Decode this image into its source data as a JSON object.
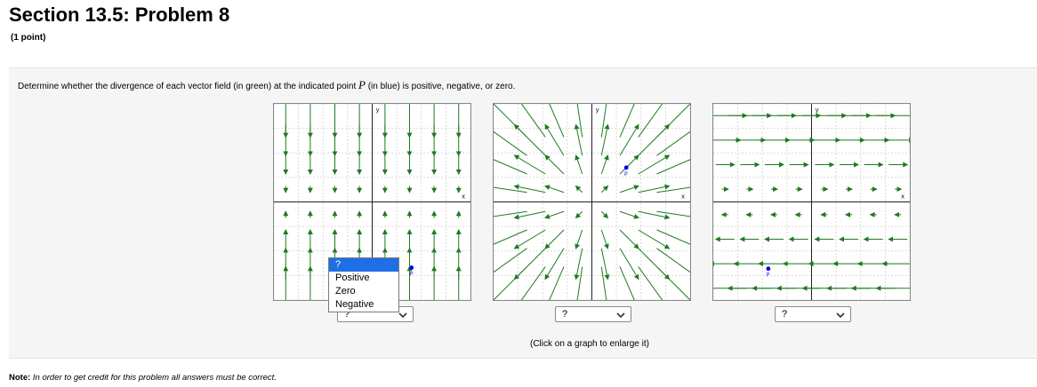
{
  "header": {
    "title": "Section 13.5: Problem 8",
    "points": "(1 point)"
  },
  "problem": {
    "text_before": "Determine whether the divergence of each vector field (in green) at the indicated point ",
    "point_symbol": "P",
    "text_after": " (in blue) is positive, negative, or zero.",
    "hint": "(Click on a graph to enlarge it)"
  },
  "graphs": [
    {
      "axis_x": "x",
      "axis_y": "y",
      "point_label": "P",
      "field": "vertical-up-bottom-down-top"
    },
    {
      "axis_x": "x",
      "axis_y": "y",
      "point_label": "P",
      "field": "radial-outward"
    },
    {
      "axis_x": "x",
      "axis_y": "y",
      "point_label": "P",
      "field": "horizontal-right-top-left-bottom"
    }
  ],
  "answers": [
    {
      "selected": "?"
    },
    {
      "selected": "?"
    },
    {
      "selected": "?"
    }
  ],
  "dropdown": {
    "options": [
      "?",
      "Positive",
      "Zero",
      "Negative"
    ]
  },
  "footer": {
    "note_label": "Note:",
    "note_text": " In order to get credit for this problem all answers must be correct."
  },
  "colors": {
    "arrow": "#1f7a1f",
    "point": "#0000ee",
    "panel_bg": "#f5f5f5",
    "highlight": "#1e6fe6"
  },
  "icons": {
    "select_chevron": "chevron-down-icon"
  }
}
